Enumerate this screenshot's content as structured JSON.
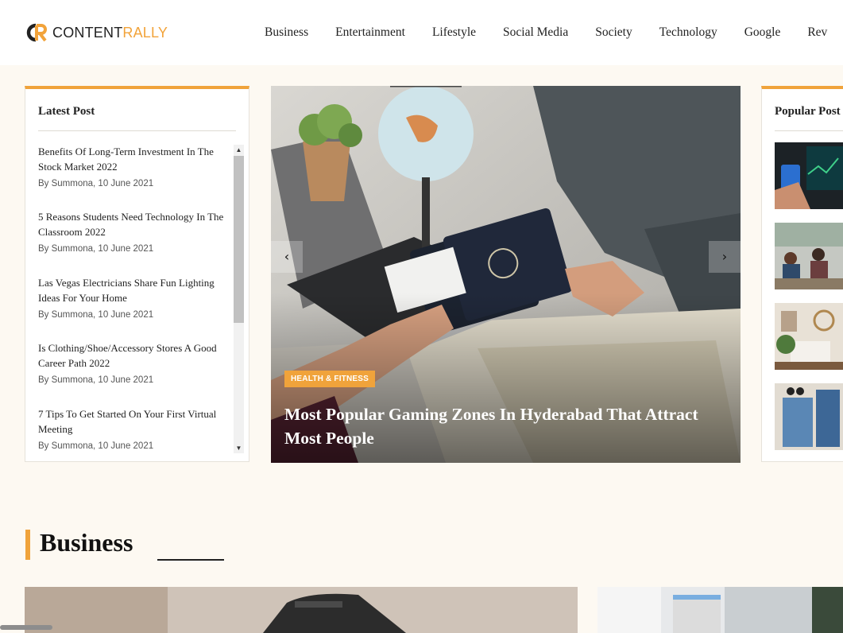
{
  "brand": {
    "part1": "CONTENT",
    "part2": "RALLY",
    "accent": "#f2a33a"
  },
  "nav": [
    "Business",
    "Entertainment",
    "Lifestyle",
    "Social Media",
    "Society",
    "Technology",
    "Google",
    "Rev"
  ],
  "latest": {
    "title": "Latest Post",
    "items": [
      {
        "title": "Benefits Of Long-Term Investment In The Stock Market 2022",
        "meta": "By Summona, 10 June 2021"
      },
      {
        "title": "5 Reasons Students Need Technology In The Classroom 2022",
        "meta": "By Summona, 10 June 2021"
      },
      {
        "title": "Las Vegas Electricians Share Fun Lighting Ideas For Your Home",
        "meta": "By Summona, 10 June 2021"
      },
      {
        "title": "Is Clothing/Shoe/Accessory Stores A Good Career Path 2022",
        "meta": "By Summona, 10 June 2021"
      },
      {
        "title": "7 Tips To Get Started On Your First Virtual Meeting",
        "meta": "By Summona, 10 June 2021"
      }
    ]
  },
  "hero": {
    "badge": "HEALTH & FITNESS",
    "title": "Most Popular Gaming Zones In Hyderabad That Attract Most People",
    "prev_icon": "chevron-left-icon",
    "next_icon": "chevron-right-icon"
  },
  "popular": {
    "title": "Popular Post"
  },
  "section": {
    "title": "Business"
  },
  "colors": {
    "accent": "#f0a33b",
    "background": "#fdf9f2"
  }
}
